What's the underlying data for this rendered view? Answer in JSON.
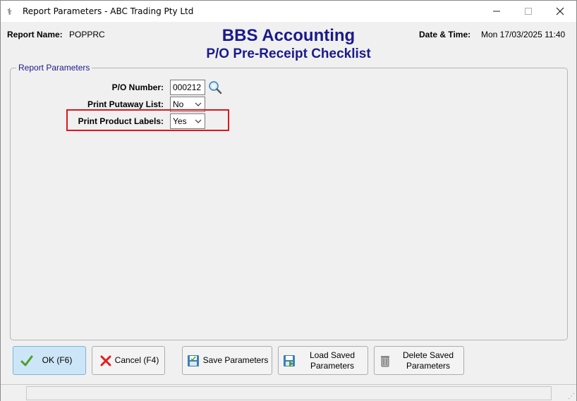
{
  "window": {
    "title": "Report Parameters - ABC Trading Pty Ltd",
    "controls": {
      "minimize": "–",
      "maximize": "☐",
      "close": "✕"
    }
  },
  "header": {
    "report_name_label": "Report Name:",
    "report_name_value": "POPPRC",
    "company": "BBS Accounting",
    "report_title": "P/O Pre-Receipt Checklist",
    "datetime_label": "Date & Time:",
    "datetime_value": "Mon 17/03/2025 11:40"
  },
  "params_group": {
    "legend": "Report Parameters",
    "po_number": {
      "label": "P/O Number:",
      "value": "000212"
    },
    "print_putaway": {
      "label": "Print Putaway List:",
      "value": "No"
    },
    "print_product_labels": {
      "label": "Print Product Labels:",
      "value": "Yes"
    }
  },
  "buttons": {
    "ok": "OK (F6)",
    "cancel": "Cancel (F4)",
    "save": "Save Parameters",
    "load_line1": "Load Saved",
    "load_line2": "Parameters",
    "delete_line1": "Delete Saved",
    "delete_line2": "Parameters"
  },
  "colors": {
    "accent": "#1a1a8c",
    "highlight": "#e0141e",
    "ok_bg": "#cde6f7"
  },
  "icons": [
    "app-icon",
    "minimize-icon",
    "maximize-icon",
    "close-icon",
    "search-icon",
    "chevron-down-icon",
    "checkmark-icon",
    "cancel-x-icon",
    "save-icon",
    "load-icon",
    "delete-bin-icon"
  ]
}
